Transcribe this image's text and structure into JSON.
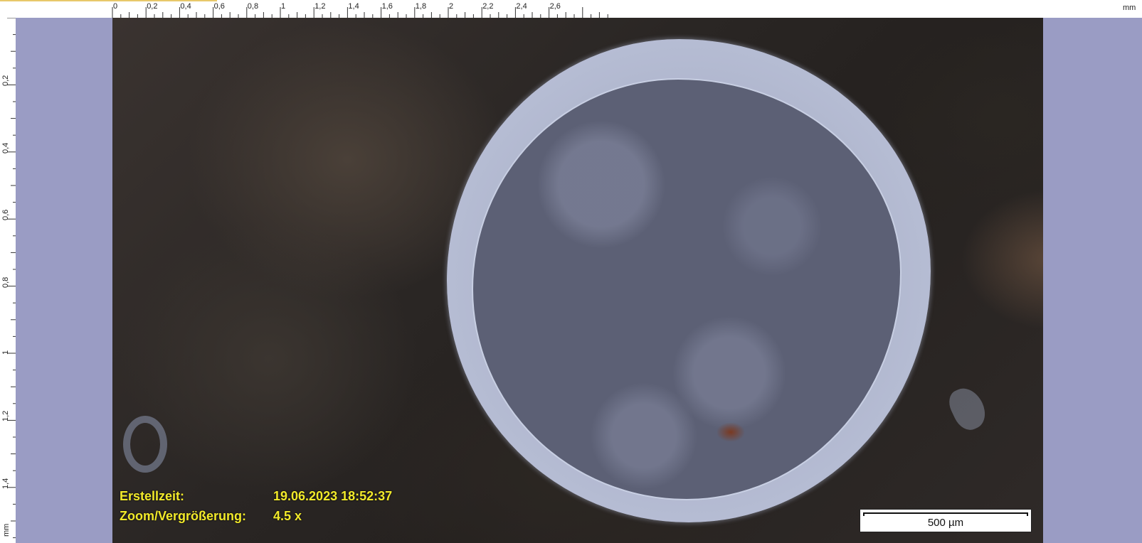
{
  "ruler": {
    "unit": "mm",
    "top_ticks": [
      "0",
      "0,2",
      "0,4",
      "0,6",
      "0,8",
      "1",
      "1,2",
      "1,4",
      "1,6",
      "1,8",
      "2",
      "2,2",
      "2,4",
      "2,6"
    ],
    "left_ticks": [
      "0,2",
      "0,4",
      "0,6",
      "0,8",
      "1",
      "1,2",
      "1,4"
    ]
  },
  "info": {
    "created_label": "Erstellzeit:",
    "created_value": "19.06.2023 18:52:37",
    "zoom_label": "Zoom/Vergrößerung:",
    "zoom_value": "4.5 x"
  },
  "scalebar": {
    "label": "500 µm"
  },
  "colors": {
    "overlay_text": "#f1e92a",
    "chrome": "#9a9cc4",
    "ruler_bg": "#ffffff"
  },
  "icons": {
    "specimen": "microscope-specimen-image"
  }
}
